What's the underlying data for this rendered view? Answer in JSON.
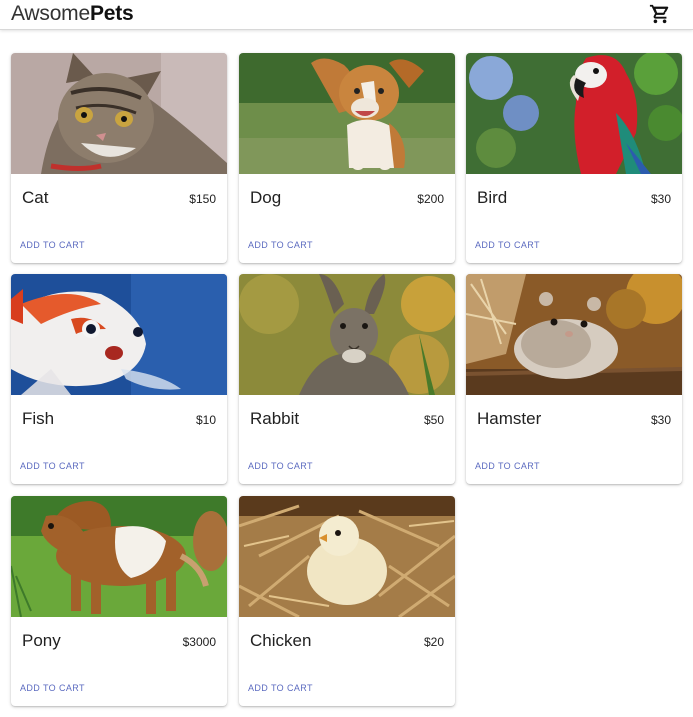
{
  "app": {
    "brand_light": "Awsome",
    "brand_bold": "Pets",
    "cart_icon": "shopping-cart-icon"
  },
  "accent_color": "#5c6bc0",
  "products": [
    {
      "name": "Cat",
      "price": "$150",
      "action": "ADD TO CART"
    },
    {
      "name": "Dog",
      "price": "$200",
      "action": "ADD TO CART"
    },
    {
      "name": "Bird",
      "price": "$30",
      "action": "ADD TO CART"
    },
    {
      "name": "Fish",
      "price": "$10",
      "action": "ADD TO CART"
    },
    {
      "name": "Rabbit",
      "price": "$50",
      "action": "ADD TO CART"
    },
    {
      "name": "Hamster",
      "price": "$30",
      "action": "ADD TO CART"
    },
    {
      "name": "Pony",
      "price": "$3000",
      "action": "ADD TO CART"
    },
    {
      "name": "Chicken",
      "price": "$20",
      "action": "ADD TO CART"
    }
  ]
}
